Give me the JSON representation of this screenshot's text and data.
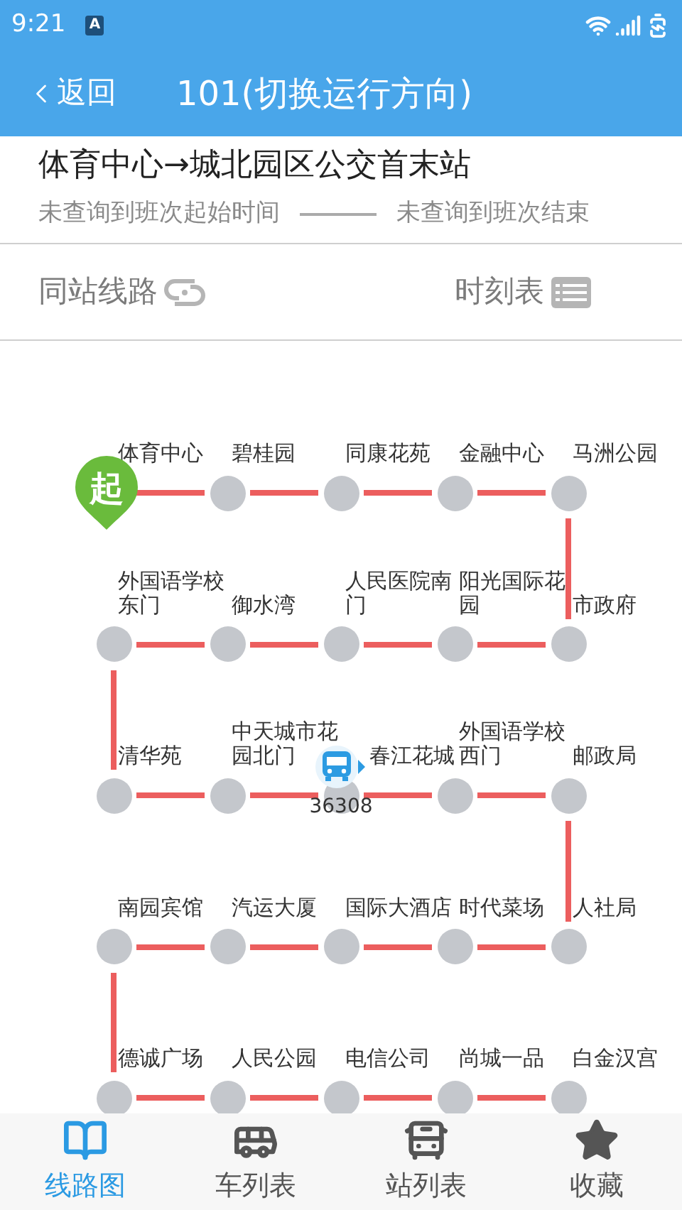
{
  "status_bar": {
    "time": "9:21",
    "badge": "A"
  },
  "header": {
    "back": "返回",
    "title": "101(切换运行方向)"
  },
  "route": {
    "name": "体育中心→城北园区公交首末站",
    "first_bus": "未查询到班次起始时间",
    "last_bus": "未查询到班次结束"
  },
  "actions": [
    {
      "label": "同站线路",
      "kind": "link"
    },
    {
      "label": "时刻表",
      "kind": "list"
    }
  ],
  "station_rows": [
    [
      {
        "name": "体育中心",
        "start": true,
        "start_label": "起"
      },
      {
        "name": "碧桂园",
        "start": false
      },
      {
        "name": "同康花苑",
        "start": false
      },
      {
        "name": "金融中心",
        "start": false
      },
      {
        "name": "马洲公园",
        "start": false
      }
    ],
    [
      {
        "name": "外国语学校东门",
        "start": false
      },
      {
        "name": "御水湾",
        "start": false
      },
      {
        "name": "人民医院南门",
        "start": false
      },
      {
        "name": "阳光国际花园",
        "start": false
      },
      {
        "name": "市政府",
        "start": false
      }
    ],
    [
      {
        "name": "清华苑",
        "start": false
      },
      {
        "name": "中天城市花园北门",
        "start": false
      },
      {
        "name": "春江花城",
        "start": false,
        "bus_plate": "36308"
      },
      {
        "name": "外国语学校西门",
        "start": false
      },
      {
        "name": "邮政局",
        "start": false
      }
    ],
    [
      {
        "name": "南园宾馆",
        "start": false
      },
      {
        "name": "汽运大厦",
        "start": false
      },
      {
        "name": "国际大酒店",
        "start": false
      },
      {
        "name": "时代菜场",
        "start": false
      },
      {
        "name": "人社局",
        "start": false
      }
    ],
    [
      {
        "name": "德诚广场",
        "start": false
      },
      {
        "name": "人民公园",
        "start": false
      },
      {
        "name": "电信公司",
        "start": false
      },
      {
        "name": "尚城一品",
        "start": false
      },
      {
        "name": "白金汉宫",
        "start": false
      }
    ]
  ],
  "nav": [
    {
      "label": "线路图",
      "kind": "map",
      "selected": true
    },
    {
      "label": "车列表",
      "kind": "bus",
      "selected": false
    },
    {
      "label": "站列表",
      "kind": "stop",
      "selected": false
    },
    {
      "label": "收藏",
      "kind": "star",
      "selected": false
    }
  ]
}
